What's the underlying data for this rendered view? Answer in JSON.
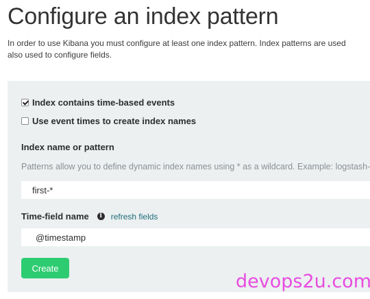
{
  "page": {
    "title": "Configure an index pattern",
    "intro_line1": "In order to use Kibana you must configure at least one index pattern. Index patterns are used",
    "intro_line2": "also used to configure fields."
  },
  "form": {
    "time_based_checkbox": {
      "label": "Index contains time-based events",
      "checked": true
    },
    "event_times_checkbox": {
      "label": "Use event times to create index names",
      "checked": false
    },
    "index_name": {
      "label": "Index name or pattern",
      "help": "Patterns allow you to define dynamic index names using * as a wildcard. Example: logstash-*",
      "value": "first-*"
    },
    "time_field": {
      "label": "Time-field name",
      "info_icon": "info-circle-icon",
      "refresh_link": "refresh fields",
      "value": "@timestamp"
    },
    "create_button": "Create"
  },
  "watermark": "devops2u.com",
  "colors": {
    "panel_bg": "#ecf0f1",
    "create_button": "#2ecc71",
    "link": "#1f6b7a",
    "watermark": "#e84ce0"
  }
}
